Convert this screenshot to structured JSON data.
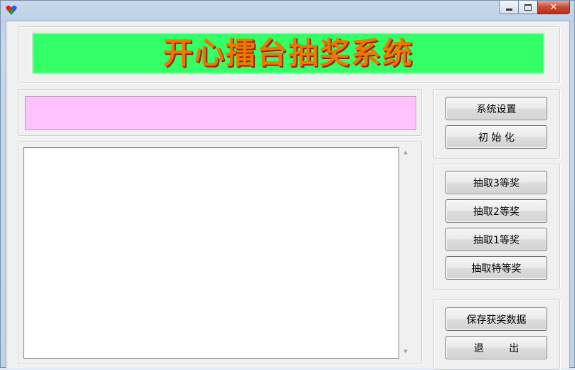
{
  "window": {
    "caption_min": "▭",
    "caption_max": "▢",
    "caption_close": "✕"
  },
  "banner": {
    "title": "开心擂台抽奖系统"
  },
  "buttons": {
    "settings": "系统设置",
    "init": "初 始 化",
    "draw3": "抽取3等奖",
    "draw2": "抽取2等奖",
    "draw1": "抽取1等奖",
    "draw_special": "抽取特等奖",
    "save": "保存获奖数据",
    "exit": "退        出"
  },
  "display": {
    "current_value": "",
    "results_text": ""
  },
  "colors": {
    "banner_bg": "#33ff66",
    "banner_text": "#f07800",
    "display_bg": "#ffc2ff"
  },
  "icons": {
    "app": "heart-icon",
    "scroll_up": "▲",
    "scroll_down": "▼"
  }
}
